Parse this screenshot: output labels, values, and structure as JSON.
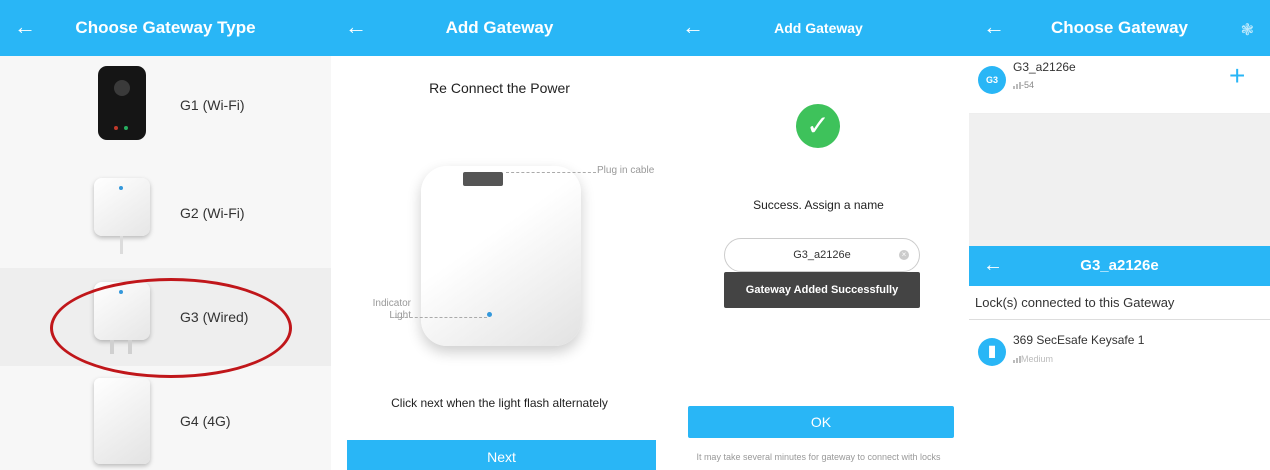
{
  "panel1": {
    "title": "Choose Gateway Type",
    "items": [
      {
        "label": "G1 (Wi-Fi)"
      },
      {
        "label": "G2 (Wi-Fi)"
      },
      {
        "label": "G3 (Wired)"
      },
      {
        "label": "G4 (4G)"
      }
    ]
  },
  "panel2": {
    "title": "Add Gateway",
    "heading": "Re Connect the Power",
    "plug_label": "Plug in cable",
    "indicator_label": "Indicator\nLight",
    "instruction": "Click next when the light flash alternately",
    "next_label": "Next"
  },
  "panel3": {
    "title": "Add Gateway",
    "success_text": "Success. Assign a name",
    "name_value": "G3_a2126e",
    "toast": "Gateway Added Successfully",
    "ok_label": "OK",
    "hint": "It may take several minutes for gateway to connect with locks"
  },
  "panel4": {
    "title": "Choose Gateway",
    "gateway_name": "G3_a2126e",
    "gateway_icon_text": "G3",
    "gateway_rssi": "-54",
    "sub_title": "G3_a2126e",
    "section_title": "Lock(s) connected to this Gateway",
    "lock_name": "369 SecEsafe Keysafe 1",
    "lock_signal": "Medium"
  },
  "colors": {
    "accent": "#29b6f6",
    "highlight_circle": "#c0161a",
    "success": "#3ec25b",
    "toast_bg": "#444444"
  },
  "icons": [
    "back-arrow-icon",
    "checkmark-icon",
    "clear-icon",
    "plus-icon",
    "spinner-icon",
    "signal-icon",
    "lock-icon",
    "gateway-icon"
  ]
}
